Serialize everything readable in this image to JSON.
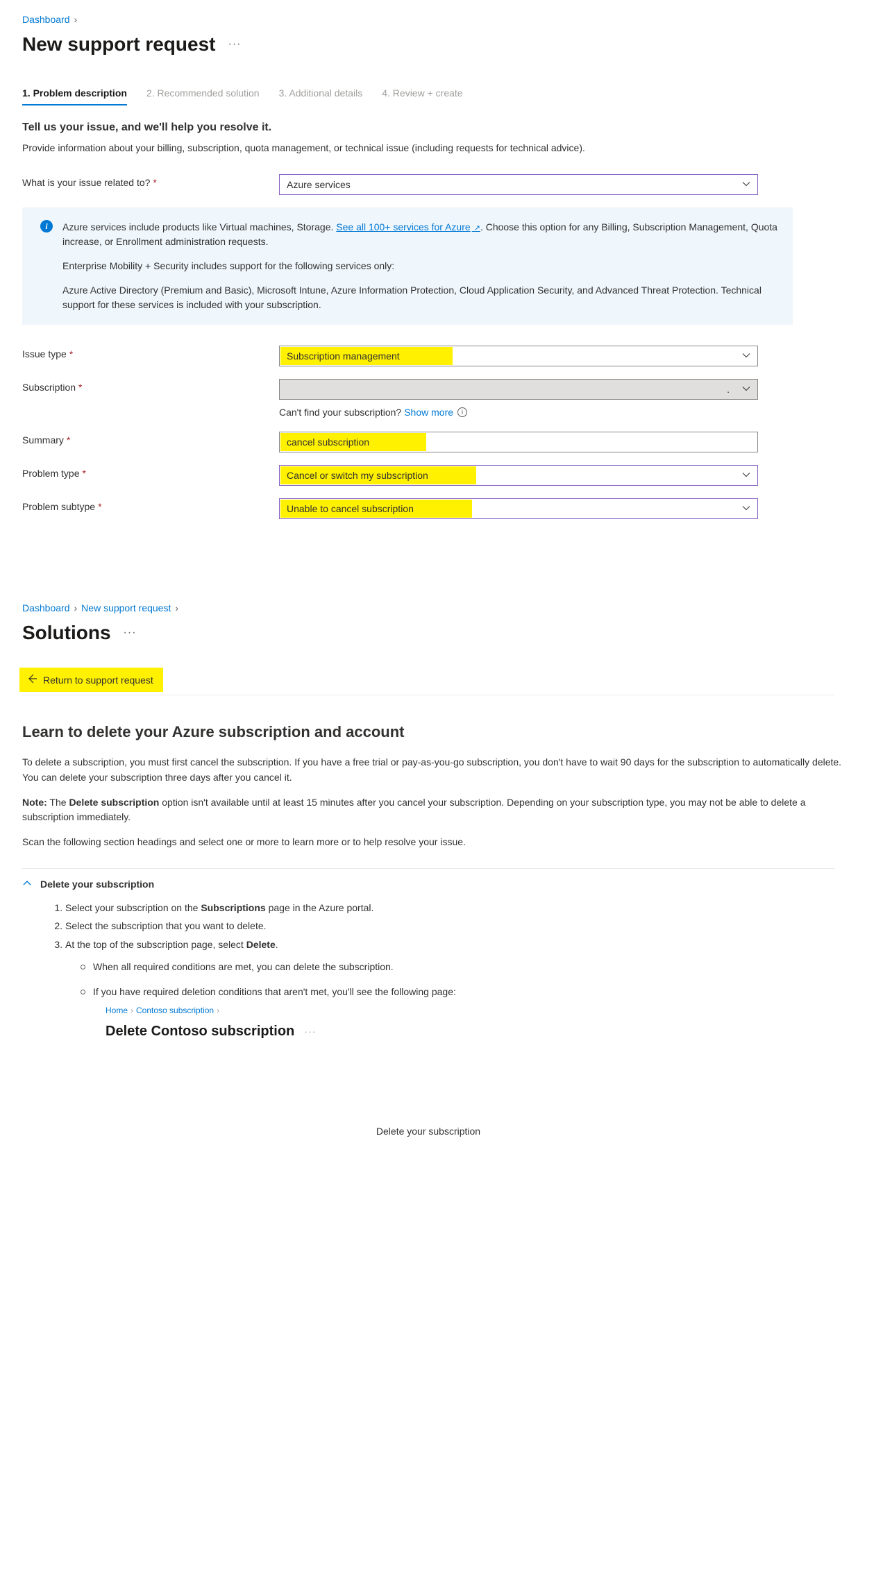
{
  "breadcrumb1": {
    "dashboard": "Dashboard"
  },
  "page_title": "New support request",
  "tabs": [
    "1. Problem description",
    "2. Recommended solution",
    "3. Additional details",
    "4. Review + create"
  ],
  "section_heading": "Tell us your issue, and we'll help you resolve it.",
  "section_desc": "Provide information about your billing, subscription, quota management, or technical issue (including requests for technical advice).",
  "form": {
    "issue_related": {
      "label": "What is your issue related to?",
      "value": "Azure services"
    },
    "issue_type": {
      "label": "Issue type",
      "value": "Subscription management"
    },
    "subscription": {
      "label": "Subscription",
      "value": "",
      "dot": "."
    },
    "summary": {
      "label": "Summary",
      "value": "cancel subscription"
    },
    "problem_type": {
      "label": "Problem type",
      "value": "Cancel or switch my subscription"
    },
    "problem_subtype": {
      "label": "Problem subtype",
      "value": "Unable to cancel subscription"
    },
    "cant_find": "Can't find your subscription?",
    "show_more": "Show more"
  },
  "info": {
    "p1a": "Azure services include products like Virtual machines, Storage. ",
    "link": "See all 100+ services for Azure",
    "p1b": ". Choose this option for any Billing, Subscription Management, Quota increase, or Enrollment administration requests.",
    "p2": "Enterprise Mobility + Security includes support for the following services only:",
    "p3": "Azure Active Directory (Premium and Basic), Microsoft Intune, Azure Information Protection, Cloud Application Security, and Advanced Threat Protection. Technical support for these services is included with your subscription."
  },
  "breadcrumb2": {
    "dashboard": "Dashboard",
    "nsr": "New support request"
  },
  "page_title2": "Solutions",
  "return_label": "Return to support request",
  "learn_h2": "Learn to delete your Azure subscription and account",
  "learn_p1": "To delete a subscription, you must first cancel the subscription. If you have a free trial or pay-as-you-go subscription, you don't have to wait 90 days for the subscription to automatically delete. You can delete your subscription three days after you cancel it.",
  "learn_note_prefix": "Note:",
  "learn_note_body_a": " The ",
  "learn_note_bold": "Delete subscription",
  "learn_note_body_b": " option isn't available until at least 15 minutes after you cancel your subscription. Depending on your subscription type, you may not be able to delete a subscription immediately.",
  "learn_scan": "Scan the following section headings and select one or more to learn more or to help resolve your issue.",
  "accordion_title": "Delete your subscription",
  "steps": {
    "s1a": "Select your subscription on the ",
    "s1b": "Subscriptions",
    "s1c": " page in the Azure portal.",
    "s2": "Select the subscription that you want to delete.",
    "s3a": "At the top of the subscription page, select ",
    "s3b": "Delete",
    "s3c": ".",
    "b1": "When all required conditions are met, you can delete the subscription.",
    "b2": "If you have required deletion conditions that aren't met, you'll see the following page:"
  },
  "nested": {
    "home": "Home",
    "contoso": "Contoso subscription",
    "title": "Delete Contoso subscription"
  },
  "footer": "Delete your subscription"
}
